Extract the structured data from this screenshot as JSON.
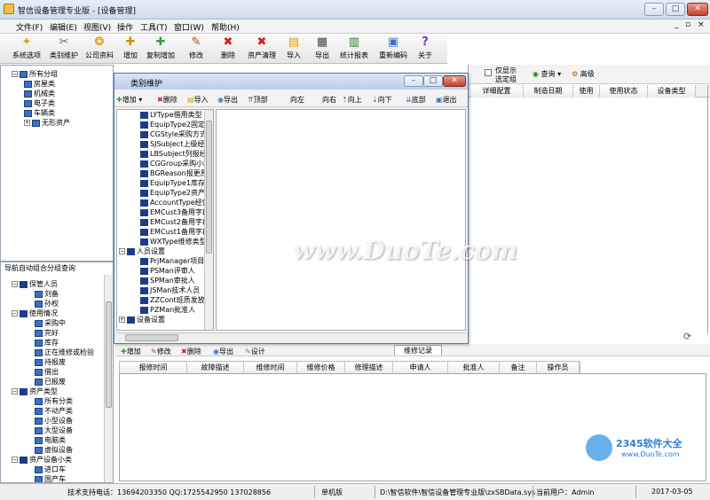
{
  "app": {
    "title": "智信设备管理专业版 - [设备管理]"
  },
  "menu": [
    "文件(F)",
    "编辑(E)",
    "视图(V)",
    "操作",
    "工具(T)",
    "窗口(W)",
    "帮助(H)"
  ],
  "toolbar": [
    "系统选项",
    "类别维护",
    "公司资料",
    "增加",
    "复制增加",
    "修改",
    "删除",
    "资产清理",
    "导入",
    "导出",
    "统计报表",
    "重新编码",
    "关于"
  ],
  "left_tree_top": {
    "root": "所有分组",
    "items": [
      "房屋类",
      "机械类",
      "电子类",
      "车辆类",
      "无形资产"
    ]
  },
  "left_tree_bottom": {
    "title": "导航自动组合分组查询",
    "groups": [
      {
        "label": "保管人员",
        "children": [
          "刘备",
          "孙权"
        ]
      },
      {
        "label": "使用情况",
        "children": [
          "采购中",
          "完好",
          "库存",
          "正在维修或检验",
          "待报废",
          "借出",
          "已报废"
        ]
      },
      {
        "label": "资产类型",
        "children": [
          "所有分类",
          "不动产类",
          "小型设备",
          "大型设备",
          "电脑类",
          "虚拟设备"
        ]
      },
      {
        "label": "资产设备小类",
        "children": [
          "进口车",
          "国产车"
        ]
      }
    ]
  },
  "dialog": {
    "title": "类别维护",
    "buttons": [
      "增加",
      "删除",
      "导入",
      "导出",
      "顶部",
      "向左",
      "向右",
      "向上",
      "向下",
      "底部",
      "退出"
    ],
    "tree_items": [
      "LYType借用类型",
      "EquipType2固定",
      "CGStyle采购方式",
      "SJSubject上级经",
      "LBSubject列报经",
      "CGGroup采购小组",
      "BGReason报更原",
      "EquipType1库存",
      "EquipType2资产",
      "AccountType经营",
      "EMCust3备用字段",
      "EMCust2备用字段",
      "EMCust1备用字段",
      "WXType维修类型"
    ],
    "group_person": "人员设置",
    "person_items": [
      "PrjManager项目经",
      "PSMan评审人",
      "SPMan审批人",
      "JSMan技术人员",
      "ZZCont班质发放",
      "PZMan批准人"
    ],
    "group_equipment": "设备设置"
  },
  "right_panel": {
    "checkbox_label_1": "仅显示",
    "checkbox_label_2": "选定组",
    "query_button": "查询",
    "advanced_button": "高级",
    "columns": [
      "详细配置",
      "制造日期",
      "使用",
      "使用状态",
      "设备类型"
    ]
  },
  "bottom_panel": {
    "buttons": [
      "增加",
      "修改",
      "删除",
      "导出",
      "设计"
    ],
    "tab": "维修记录",
    "columns": [
      "报修时间",
      "故障描述",
      "维修时间",
      "维修价格",
      "修理描述",
      "申请人",
      "批准人",
      "备注",
      "操作员"
    ]
  },
  "statusbar": {
    "support": "技术支持电话：13694203350 QQ:1725542950 137028856",
    "mode": "单机版",
    "path": "D:\\智信软件\\智信设备管理专业版\\zxSBData.sys",
    "user": "当前用户：Admin",
    "date": "2017-03-05"
  },
  "watermark": {
    "text": "www.DuoTe.com",
    "logo": "2345软件大全",
    "logo_url": "www.DuoTe.com"
  },
  "colors": {
    "accent": "#3a6fc8",
    "title_bg": "#dbe5f2",
    "close_btn": "#c2432f"
  }
}
